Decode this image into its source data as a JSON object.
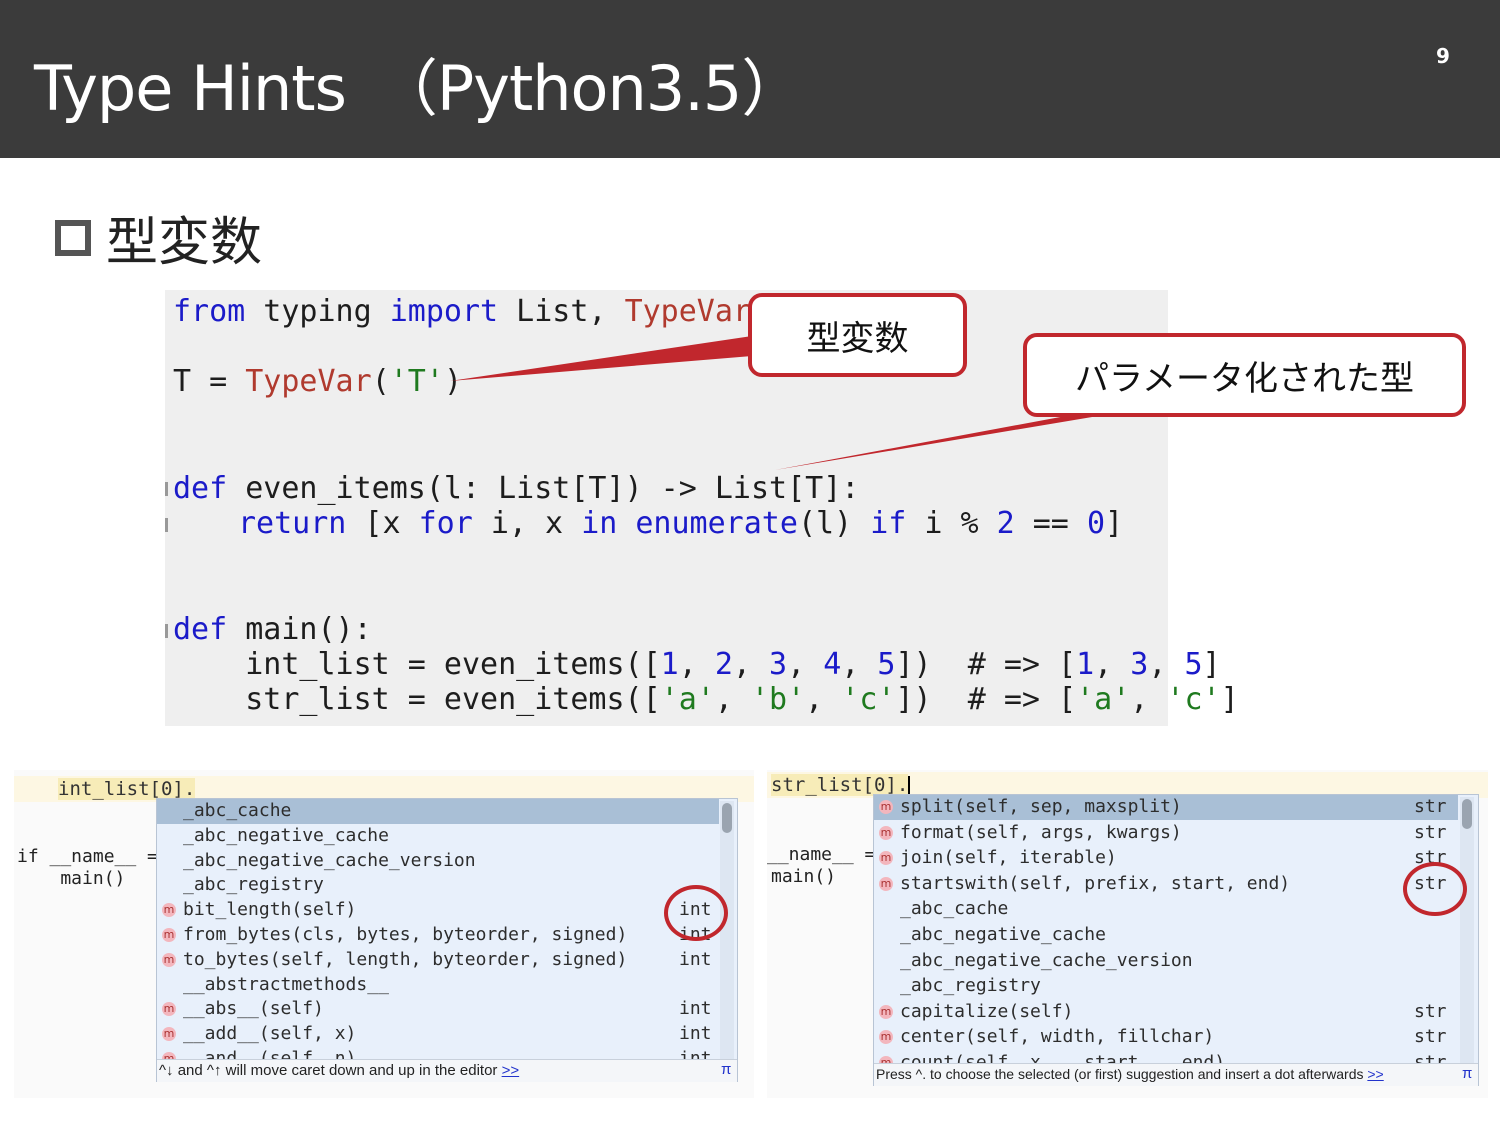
{
  "slide": {
    "title": "Type Hints　（Python3.5）",
    "page_number": "9",
    "bullet": "型変数"
  },
  "code": {
    "line1": {
      "from": "from",
      "mod": " typing ",
      "imp": "import",
      "names": " List, ",
      "tv": "TypeVar"
    },
    "line2": {
      "lhs": "T = ",
      "call": "TypeVar",
      "open": "(",
      "arg": "'T'",
      "close": ")"
    },
    "line3": {
      "def": "def",
      "sig": " even_items(l: List[T]) -> List[T]:"
    },
    "line4": {
      "ret": "return",
      "a": " [x ",
      "for": "for",
      "b": " i, x ",
      "in": "in",
      "enum": " enumerate",
      "c": "(l) ",
      "if": "if",
      "d": " i % ",
      "two": "2",
      "e": " == ",
      "zero": "0",
      "f": "]"
    },
    "line5": {
      "def": "def",
      "sig": " main():"
    },
    "line6": {
      "a": "    int_list = even_items([",
      "n1": "1",
      "s1": ", ",
      "n2": "2",
      "s2": ", ",
      "n3": "3",
      "s3": ", ",
      "n4": "4",
      "s4": ", ",
      "n5": "5",
      "b": "])  # => [",
      "r1": "1",
      "t1": ", ",
      "r3": "3",
      "t2": ", ",
      "r5": "5",
      "c": "]"
    },
    "line7": {
      "a": "    str_list = even_items([",
      "sa": "'a'",
      "s1": ", ",
      "sb": "'b'",
      "s2": ", ",
      "sc": "'c'",
      "b": "])  # => [",
      "ra": "'a'",
      "t1": ", ",
      "rc": "'c'",
      "c": "]"
    }
  },
  "callouts": {
    "typevar": "型変数",
    "parameterized": "パラメータ化された型"
  },
  "left_panel": {
    "editor_line": "int_list[0].",
    "bg_line1": "if __name__ ==",
    "bg_line2": "    main()",
    "items": [
      {
        "icon": "",
        "label": "_abc_cache",
        "type": ""
      },
      {
        "icon": "",
        "label": "_abc_negative_cache",
        "type": ""
      },
      {
        "icon": "",
        "label": "_abc_negative_cache_version",
        "type": ""
      },
      {
        "icon": "",
        "label": "_abc_registry",
        "type": ""
      },
      {
        "icon": "m",
        "label": "bit_length(self)",
        "type": "int"
      },
      {
        "icon": "m",
        "label": "from_bytes(cls, bytes, byteorder, signed)",
        "type": "int"
      },
      {
        "icon": "m",
        "label": "to_bytes(self, length, byteorder, signed)",
        "type": "int"
      },
      {
        "icon": "",
        "label": "__abstractmethods__",
        "type": ""
      },
      {
        "icon": "m",
        "label": "__abs__(self)",
        "type": "int"
      },
      {
        "icon": "m",
        "label": "__add__(self, x)",
        "type": "int"
      },
      {
        "icon": "m",
        "label": "__and__(self, n)",
        "type": "int"
      }
    ],
    "hint": "^↓ and ^↑ will move caret down and up in the editor",
    "hint_link": ">>",
    "pi": "π"
  },
  "right_panel": {
    "editor_line": "str_list[0].",
    "bg_line1": "__name__ ==",
    "bg_line2": "main()",
    "items": [
      {
        "icon": "m",
        "label": "split(self, sep, maxsplit)",
        "type": "str"
      },
      {
        "icon": "m",
        "label": "format(self, args, kwargs)",
        "type": "str"
      },
      {
        "icon": "m",
        "label": "join(self, iterable)",
        "type": "str"
      },
      {
        "icon": "m",
        "label": "startswith(self, prefix, start, end)",
        "type": "str"
      },
      {
        "icon": "",
        "label": "_abc_cache",
        "type": ""
      },
      {
        "icon": "",
        "label": "_abc_negative_cache",
        "type": ""
      },
      {
        "icon": "",
        "label": "_abc_negative_cache_version",
        "type": ""
      },
      {
        "icon": "",
        "label": "_abc_registry",
        "type": ""
      },
      {
        "icon": "m",
        "label": "capitalize(self)",
        "type": "str"
      },
      {
        "icon": "m",
        "label": "center(self, width, fillchar)",
        "type": "str"
      },
      {
        "icon": "m",
        "label": "count(self, x, __start, __end)",
        "type": "str"
      }
    ],
    "hint": "Press ^. to choose the selected (or first) suggestion and insert a dot afterwards",
    "hint_link": ">>",
    "pi": "π"
  },
  "colors": {
    "header_bg": "#3b3b3b",
    "keyword": "#1b1bc9",
    "class_name": "#b03a2e",
    "string": "#1f7a1f",
    "callout_border": "#c1272d",
    "popup_bg": "#e8f0fb",
    "popup_selected": "#a9bfd6"
  }
}
